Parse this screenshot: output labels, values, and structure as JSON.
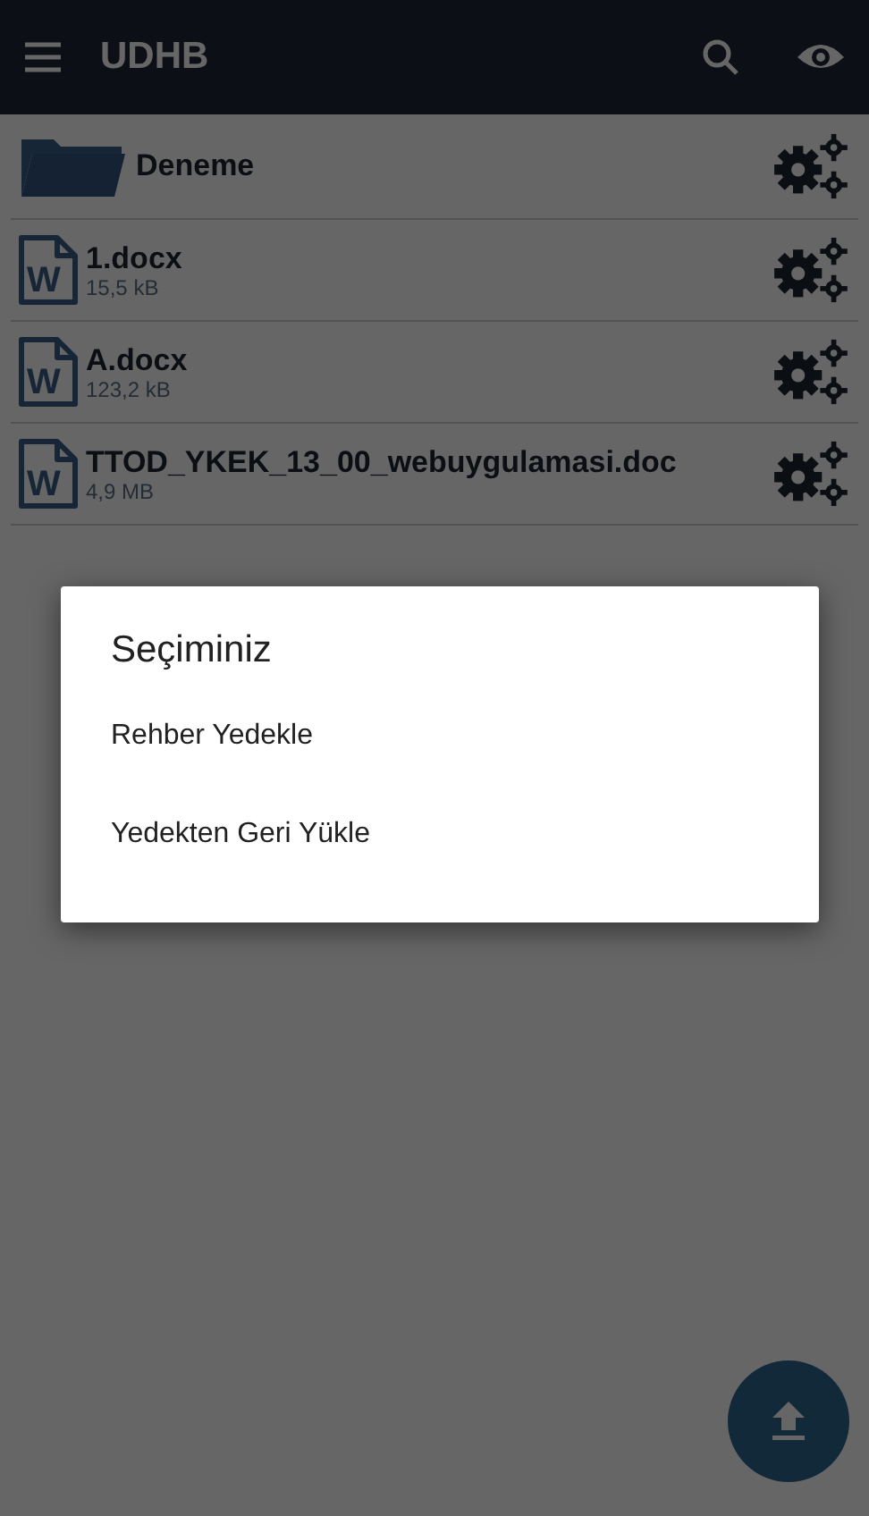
{
  "app_bar": {
    "title": "UDHB"
  },
  "files": [
    {
      "kind": "folder",
      "name": "Deneme"
    },
    {
      "kind": "file",
      "icon_letter": "W",
      "name": "1.docx",
      "size": "15,5 kB"
    },
    {
      "kind": "file",
      "icon_letter": "W",
      "name": "A.docx",
      "size": "123,2 kB"
    },
    {
      "kind": "file",
      "icon_letter": "W",
      "name": "TTOD_YKEK_13_00_webuygulamasi.doc",
      "size": "4,9 MB"
    }
  ],
  "dialog": {
    "title": "Seçiminiz",
    "options": [
      "Rehber Yedekle",
      "Yedekten Geri Yükle"
    ]
  }
}
